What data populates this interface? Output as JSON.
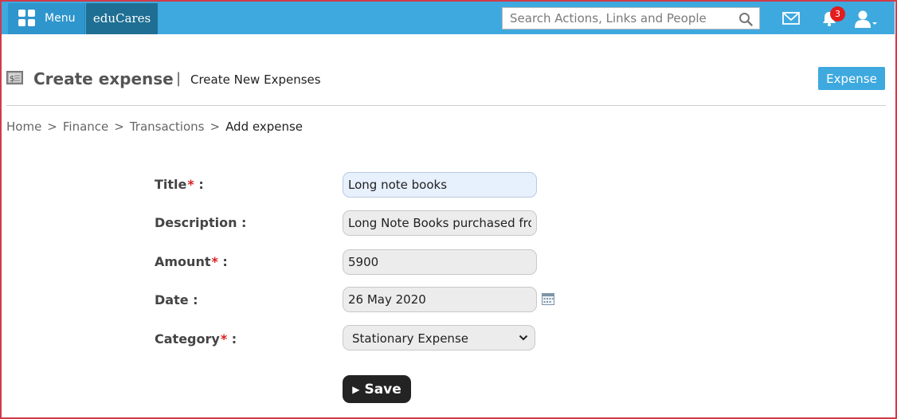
{
  "topbar": {
    "menu_label": "Menu",
    "brand": "eduCares",
    "search_placeholder": "Search Actions, Links and People",
    "notification_count": "3",
    "accent": "#3ea9df"
  },
  "header": {
    "title": "Create expense",
    "separator": "|",
    "subtitle": "Create New Expenses",
    "action_button": "Expense"
  },
  "breadcrumb": {
    "items": [
      "Home",
      "Finance",
      "Transactions"
    ],
    "current": "Add expense",
    "separator": ">"
  },
  "form": {
    "title": {
      "label": "Title",
      "required_mark": "*",
      "colon": " :",
      "value": "Long note books"
    },
    "description": {
      "label": "Description :",
      "value": "Long Note Books purchased from"
    },
    "amount": {
      "label": "Amount",
      "required_mark": "*",
      "colon": " :",
      "value": "5900"
    },
    "date": {
      "label": "Date :",
      "value": "26 May 2020"
    },
    "category": {
      "label": "Category",
      "required_mark": "*",
      "colon": " :",
      "value": "Stationary Expense"
    },
    "save_label": "Save"
  }
}
